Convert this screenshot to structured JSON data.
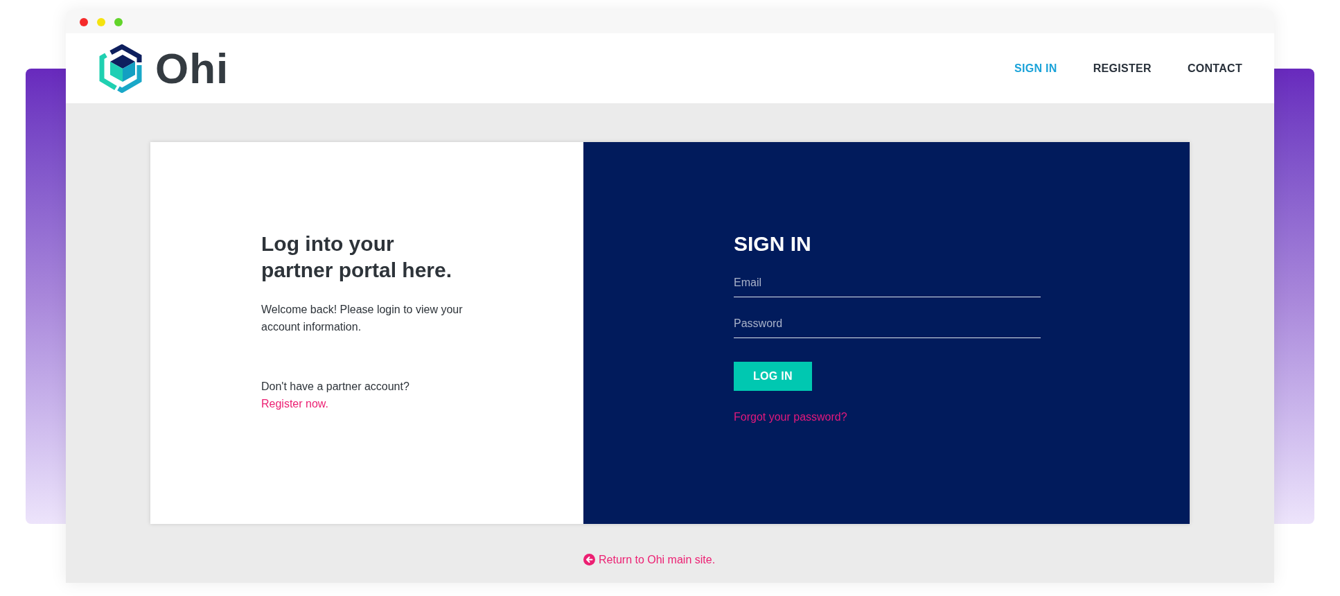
{
  "window_controls": [
    {
      "color": "#f52a2a"
    },
    {
      "color": "#f5e30f"
    },
    {
      "color": "#62d42a"
    }
  ],
  "header": {
    "logo": "Ohi",
    "nav": [
      {
        "label": "SIGN IN",
        "selected": true
      },
      {
        "label": "REGISTER",
        "selected": false
      },
      {
        "label": "CONTACT",
        "selected": false
      }
    ]
  },
  "intro": {
    "heading": "Log into your partner portal here.",
    "text": "Welcome back! Please login to view your account information.",
    "register_prompt": "Don't have a partner account?",
    "register_link": "Register now."
  },
  "sign_in": {
    "heading": "SIGN IN",
    "fields": [
      {
        "placeholder": "Email"
      },
      {
        "placeholder": "Password"
      }
    ],
    "button": "LOG IN",
    "forgot_link": "Forgot your password?"
  },
  "return_link": "Return to Ohi main site."
}
